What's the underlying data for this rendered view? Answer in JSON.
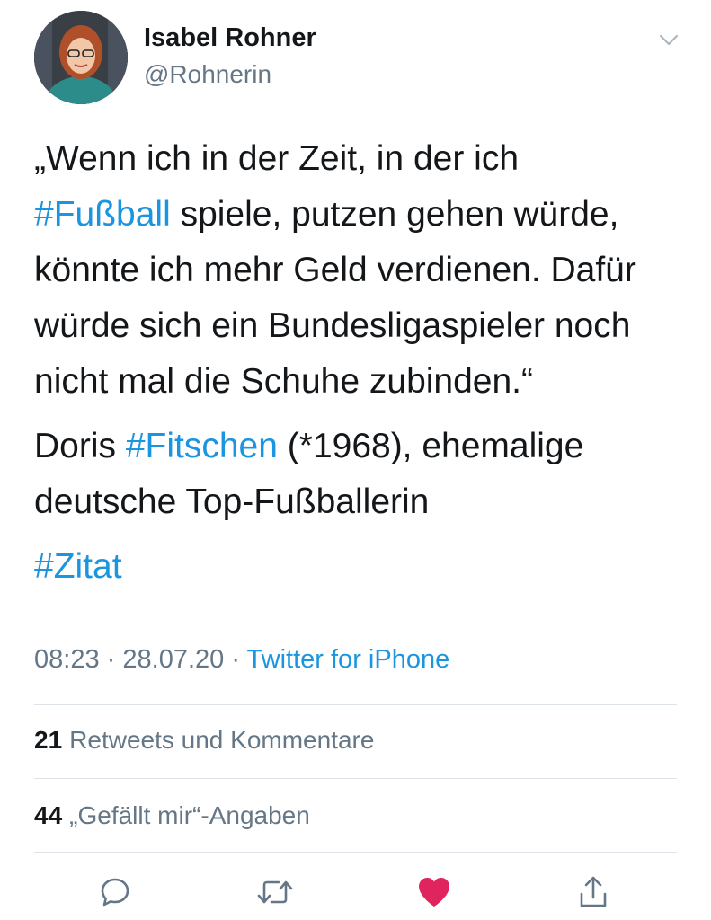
{
  "author": {
    "display_name": "Isabel Rohner",
    "handle": "@Rohnerin",
    "avatar_icon": "profile-photo"
  },
  "tweet": {
    "lines_p1": [
      [
        {
          "text": "„Wenn ich in der Zeit, in der ich"
        }
      ],
      [
        {
          "text": "#Fußball",
          "hashtag": true
        },
        {
          "text": " spiele, putzen gehen würde,"
        }
      ],
      [
        {
          "text": "könnte ich mehr Geld verdienen. Dafür"
        }
      ],
      [
        {
          "text": "würde sich ein Bundesligaspieler noch"
        }
      ],
      [
        {
          "text": "nicht mal die Schuhe zubinden.“"
        }
      ]
    ],
    "lines_p2": [
      [
        {
          "text": "Doris "
        },
        {
          "text": "#Fitschen",
          "hashtag": true
        },
        {
          "text": " (*1968), ehemalige"
        }
      ],
      [
        {
          "text": "deutsche Top-Fußballerin"
        }
      ]
    ],
    "lines_p3": [
      [
        {
          "text": "#Zitat",
          "hashtag": true
        }
      ]
    ],
    "time": "08:23",
    "date": "28.07.20",
    "separator": "·",
    "source": "Twitter for iPhone"
  },
  "stats": {
    "retweets_count": "21",
    "retweets_label": "Retweets und Kommentare",
    "likes_count": "44",
    "likes_label": "„Gefällt mir“-Angaben"
  },
  "actions": {
    "reply_icon": "comment-icon",
    "retweet_icon": "retweet-icon",
    "like_icon": "heart-icon",
    "share_icon": "share-icon"
  },
  "colors": {
    "text": "#14171a",
    "secondary": "#657786",
    "link": "#1b95e0",
    "like": "#e0245e",
    "divider": "#dde3e8"
  }
}
